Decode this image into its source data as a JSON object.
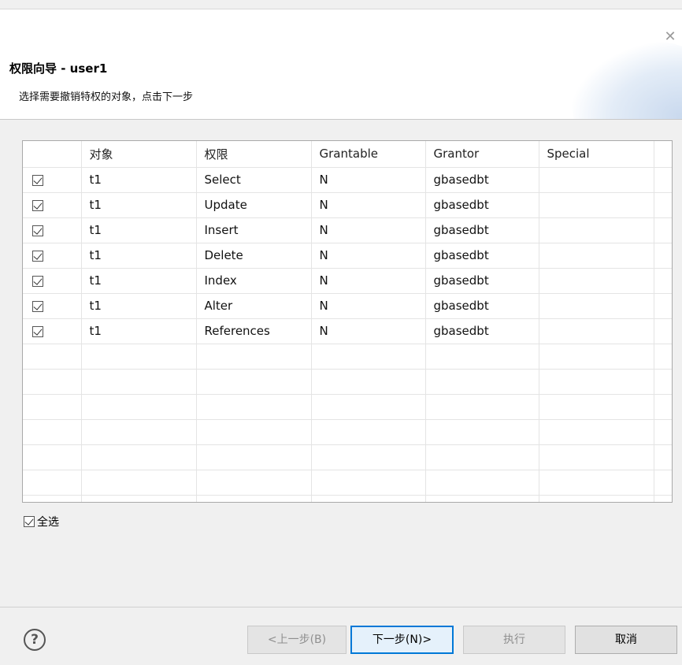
{
  "header": {
    "title": "权限向导 - user1",
    "subtitle": "选择需要撤销特权的对象，点击下一步"
  },
  "table": {
    "columns": [
      "",
      "对象",
      "权限",
      "Grantable",
      "Grantor",
      "Special"
    ],
    "rows": [
      {
        "checked": true,
        "object": "t1",
        "privilege": "Select",
        "grantable": "N",
        "grantor": "gbasedbt",
        "special": ""
      },
      {
        "checked": true,
        "object": "t1",
        "privilege": "Update",
        "grantable": "N",
        "grantor": "gbasedbt",
        "special": ""
      },
      {
        "checked": true,
        "object": "t1",
        "privilege": "Insert",
        "grantable": "N",
        "grantor": "gbasedbt",
        "special": ""
      },
      {
        "checked": true,
        "object": "t1",
        "privilege": "Delete",
        "grantable": "N",
        "grantor": "gbasedbt",
        "special": ""
      },
      {
        "checked": true,
        "object": "t1",
        "privilege": "Index",
        "grantable": "N",
        "grantor": "gbasedbt",
        "special": ""
      },
      {
        "checked": true,
        "object": "t1",
        "privilege": "Alter",
        "grantable": "N",
        "grantor": "gbasedbt",
        "special": ""
      },
      {
        "checked": true,
        "object": "t1",
        "privilege": "References",
        "grantable": "N",
        "grantor": "gbasedbt",
        "special": ""
      }
    ]
  },
  "select_all": {
    "label": "全选",
    "checked": true
  },
  "buttons": {
    "back": "<上一步(B)",
    "next": "下一步(N)>",
    "execute": "执行",
    "cancel": "取消"
  },
  "icons": {
    "close": "close-icon",
    "help": "help-icon"
  }
}
